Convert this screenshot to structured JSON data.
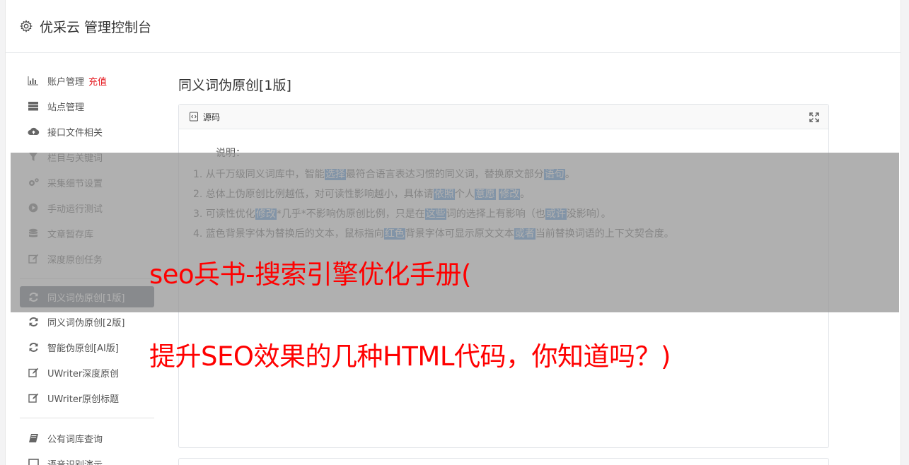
{
  "header": {
    "title": "优采云 管理控制台",
    "icon": "gear-icon"
  },
  "sidebar": {
    "group1": [
      {
        "label": "账户管理",
        "badge": "充值",
        "icon": "bar-chart-icon"
      },
      {
        "label": "站点管理",
        "icon": "server-icon"
      },
      {
        "label": "接口文件相关",
        "icon": "cloud-upload-icon"
      },
      {
        "label": "栏目与关键词",
        "icon": "filter-icon"
      },
      {
        "label": "采集细节设置",
        "icon": "cogs-icon"
      },
      {
        "label": "手动运行测试",
        "icon": "play-circle-icon"
      },
      {
        "label": "文章暂存库",
        "icon": "database-icon"
      },
      {
        "label": "深度原创任务",
        "icon": "edit-icon"
      }
    ],
    "group2": [
      {
        "label": "同义词伪原创[1版]",
        "icon": "refresh-icon",
        "active": true
      },
      {
        "label": "同义词伪原创[2版]",
        "icon": "refresh-icon"
      },
      {
        "label": "智能伪原创[AI版]",
        "icon": "refresh-icon"
      },
      {
        "label": "UWriter深度原创",
        "icon": "edit-icon"
      },
      {
        "label": "UWriter原创标题",
        "icon": "edit-icon"
      }
    ],
    "group3": [
      {
        "label": "公有词库查询",
        "icon": "book-icon"
      },
      {
        "label": "语音识别演示",
        "icon": "desktop-icon"
      }
    ]
  },
  "main": {
    "title": "同义词伪原创[1版]",
    "panel_title": "源码",
    "intro": "说明：",
    "items": [
      [
        "1. 从千万级同义词库中，智能",
        "选择",
        "最符合语言表达习惯的同义词，替换原文部分",
        "语句",
        "。"
      ],
      [
        "2. 总体上伪原创比例越低，对可读性影响越小，具体请",
        "依照",
        "个人",
        "意愿",
        " ",
        "修改",
        "。"
      ],
      [
        "3. 可读性优化",
        "修改",
        "*几乎*不影响伪原创比例，只是在",
        "这些",
        "词的选择上有影响（也",
        "或许",
        "没影响）。"
      ],
      [
        "4. 蓝色背景字体为替换后的文本，鼠标指向",
        "红色",
        "背景字体可显示原文文本",
        "或者",
        "当前替换词语的上下文契合度。"
      ]
    ]
  },
  "overlay": {
    "line1": "seo兵书-搜索引擎优化手册(",
    "line2": "提升SEO效果的几种HTML代码，你知道吗？)"
  },
  "colors": {
    "accent_red": "#ff0000",
    "highlight_blue": "#4a90d9",
    "active_bg": "#626a75"
  }
}
